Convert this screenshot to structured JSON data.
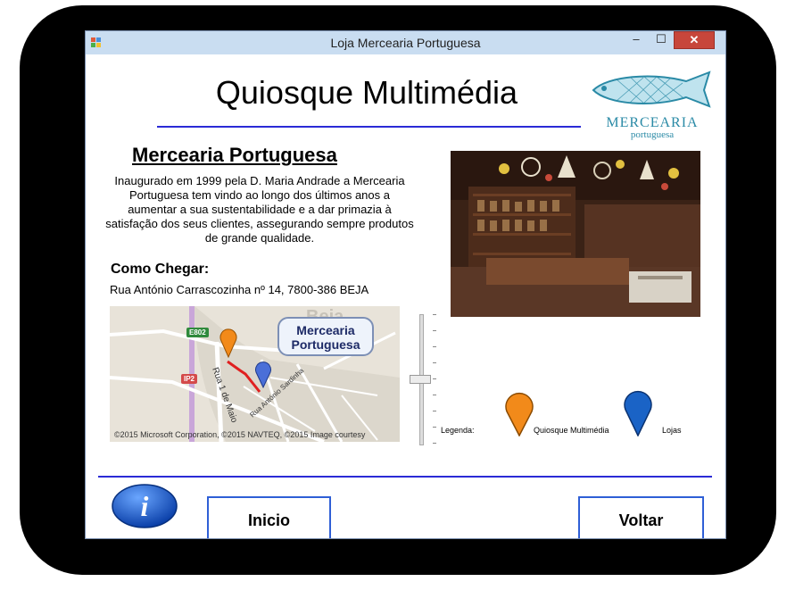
{
  "window": {
    "title": "Loja Mercearia Portuguesa",
    "minimize_glyph": "–",
    "maximize_glyph": "☐",
    "close_glyph": "✕"
  },
  "header": {
    "title": "Quiosque Multimédia"
  },
  "logo": {
    "word": "MERCEARIA",
    "sub": "portuguesa"
  },
  "about": {
    "title": "Mercearia Portuguesa",
    "description": "Inaugurado em 1999 pela D. Maria Andrade a Mercearia Portuguesa tem vindo ao longo dos últimos anos a aumentar a sua sustentabilidade e a dar primazia à satisfação dos seus clientes, assegurando sempre produtos de grande qualidade."
  },
  "directions": {
    "label": "Como Chegar:",
    "address": "Rua António Carrascozinha nº 14, 7800-386 BEJA"
  },
  "map": {
    "callout_line1": "Mercearia",
    "callout_line2": "Portuguesa",
    "road_e802": "E802",
    "road_ip2": "IP2",
    "street_1": "Rua 1 de Maio",
    "street_2": "Rua António Sardinha",
    "copyright": "©2015 Microsoft Corporation, ©2015 NAVTEQ, ©2015 Image courtesy"
  },
  "legend": {
    "label": "Legenda:",
    "kiosk": "Quiosque Multimédia",
    "stores": "Lojas",
    "kiosk_color": "#f28a1a",
    "stores_color": "#1a63c6"
  },
  "buttons": {
    "inicio": "Inicio",
    "voltar": "Voltar",
    "info_glyph": "i"
  },
  "colors": {
    "accent": "#2b2bd6",
    "button_border": "#2f5fd6",
    "titlebar": "#c9ddf1",
    "close": "#c7463b"
  }
}
